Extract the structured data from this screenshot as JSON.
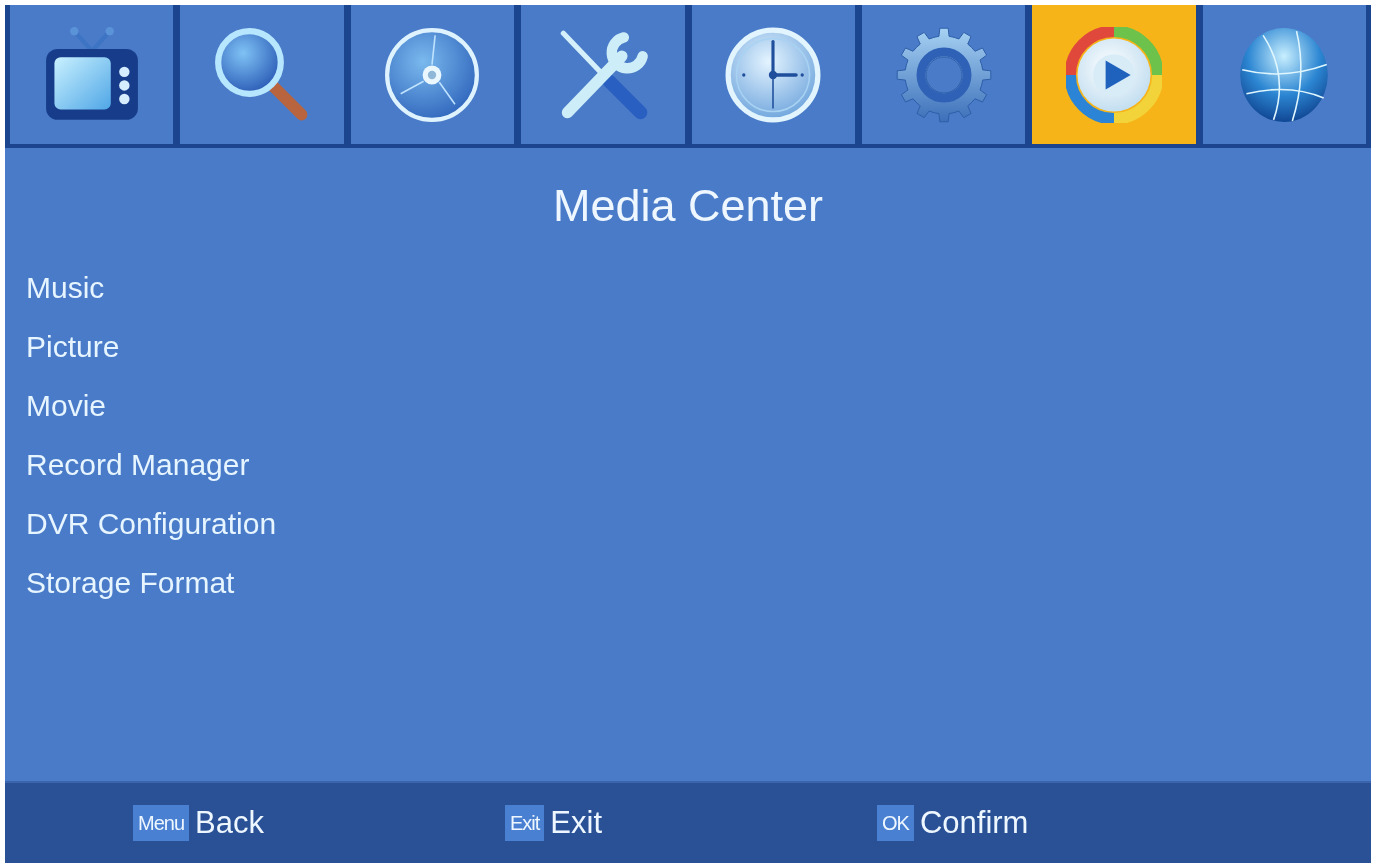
{
  "tabs": [
    {
      "kind": "tv",
      "selected": false
    },
    {
      "kind": "search",
      "selected": false
    },
    {
      "kind": "disc",
      "selected": false
    },
    {
      "kind": "tools",
      "selected": false
    },
    {
      "kind": "clock",
      "selected": false
    },
    {
      "kind": "gear",
      "selected": false
    },
    {
      "kind": "media",
      "selected": true
    },
    {
      "kind": "globe",
      "selected": false
    }
  ],
  "title": "Media Center",
  "menu_items": [
    "Music",
    "Picture",
    "Movie",
    "Record Manager",
    "DVR Configuration",
    "Storage Format"
  ],
  "footer": [
    {
      "key": "Menu",
      "label": "Back"
    },
    {
      "key": "Exit",
      "label": "Exit"
    },
    {
      "key": "OK",
      "label": "Confirm"
    }
  ]
}
